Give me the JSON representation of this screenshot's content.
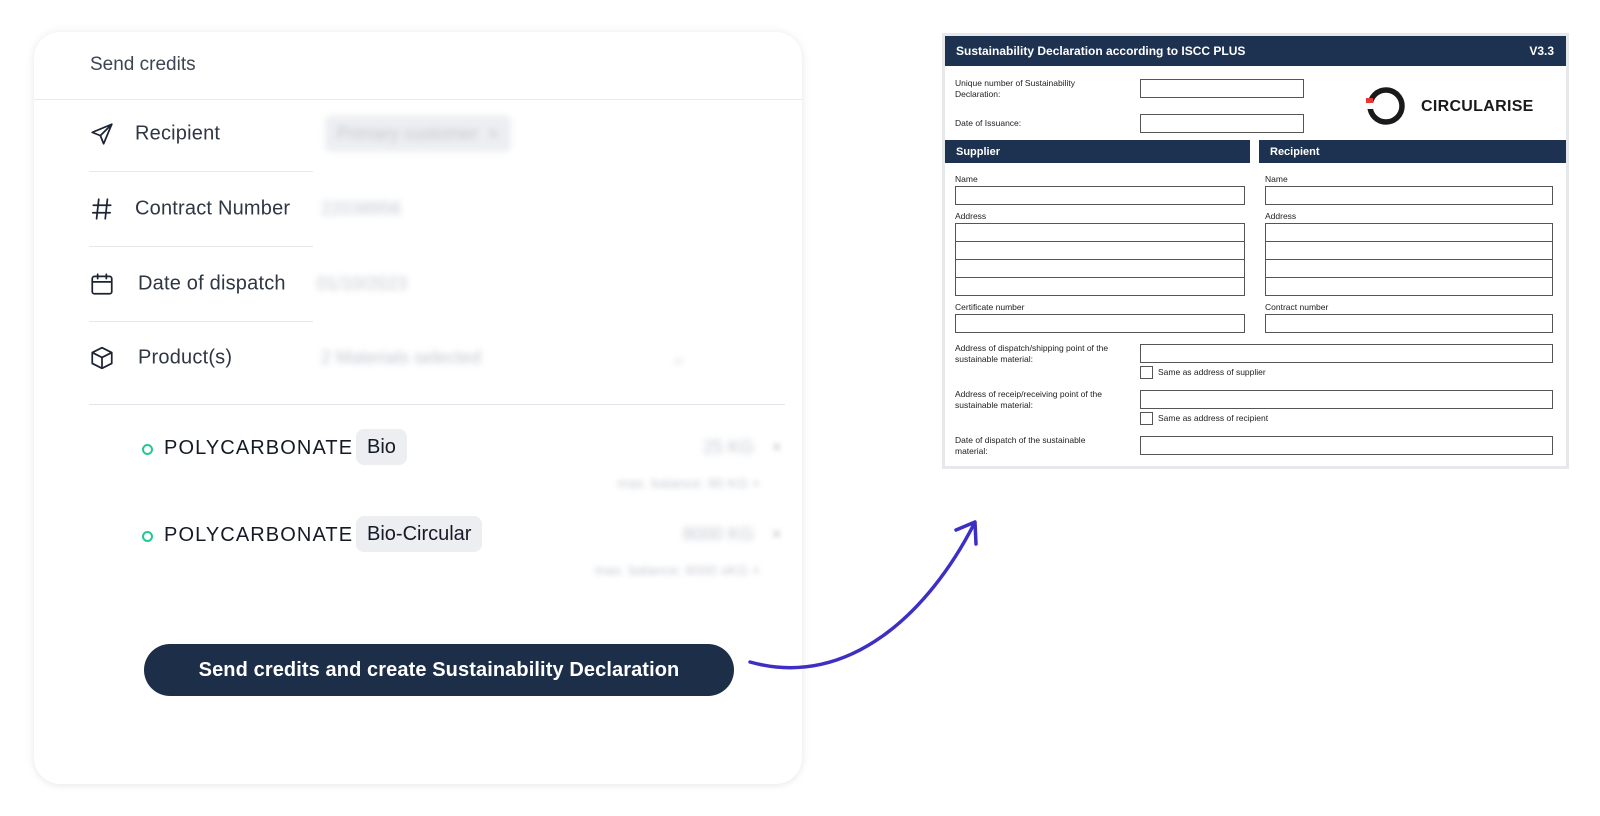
{
  "send_credits": {
    "title": "Send credits",
    "rows": [
      {
        "label": "Recipient",
        "value": "Primary customer",
        "icon": "send-icon"
      },
      {
        "label": "Contract Number",
        "value": "22038956",
        "icon": "hash-icon"
      },
      {
        "label": "Date of dispatch",
        "value": "01/10/2023",
        "icon": "calendar-icon"
      },
      {
        "label": "Product(s)",
        "value": "2 Materials selected",
        "icon": "box-icon"
      }
    ],
    "products": [
      {
        "name": "POLYCARBONATE",
        "tag": "Bio",
        "quantity": "25",
        "unit": "KG",
        "balance": "max. balance: 80 KG"
      },
      {
        "name": "POLYCARBONATE",
        "tag": "Bio-Circular",
        "quantity": "8000",
        "unit": "KG",
        "balance": "max. balance: 8000 sKG"
      }
    ],
    "remove_symbol": "×",
    "submit_label": "Send credits and create Sustainability Declaration"
  },
  "declaration": {
    "title": "Sustainability Declaration according to ISCC PLUS",
    "version": "V3.3",
    "unique_number_label": "Unique number of Sustainability Declaration:",
    "date_issuance_label": "Date of Issuance:",
    "logo_text": "CIRCULARISE",
    "supplier": {
      "heading": "Supplier",
      "name_label": "Name",
      "address_label": "Address",
      "certificate_label": "Certificate number"
    },
    "recipient": {
      "heading": "Recipient",
      "name_label": "Name",
      "address_label": "Address",
      "contract_label": "Contract number"
    },
    "dispatch_address_label": "Address of dispatch/shipping point of the sustainable material:",
    "same_as_supplier": "Same as address of supplier",
    "receipt_address_label": "Address of receip/receiving point of the sustainable material:",
    "same_as_recipient": "Same as address of recipient",
    "dispatch_date_label": "Date of dispatch of the sustainable material:"
  },
  "colors": {
    "navy": "#1c2e48",
    "green_dot": "#22c993",
    "arrow": "#3d2fc4",
    "logo_red": "#e53935"
  }
}
